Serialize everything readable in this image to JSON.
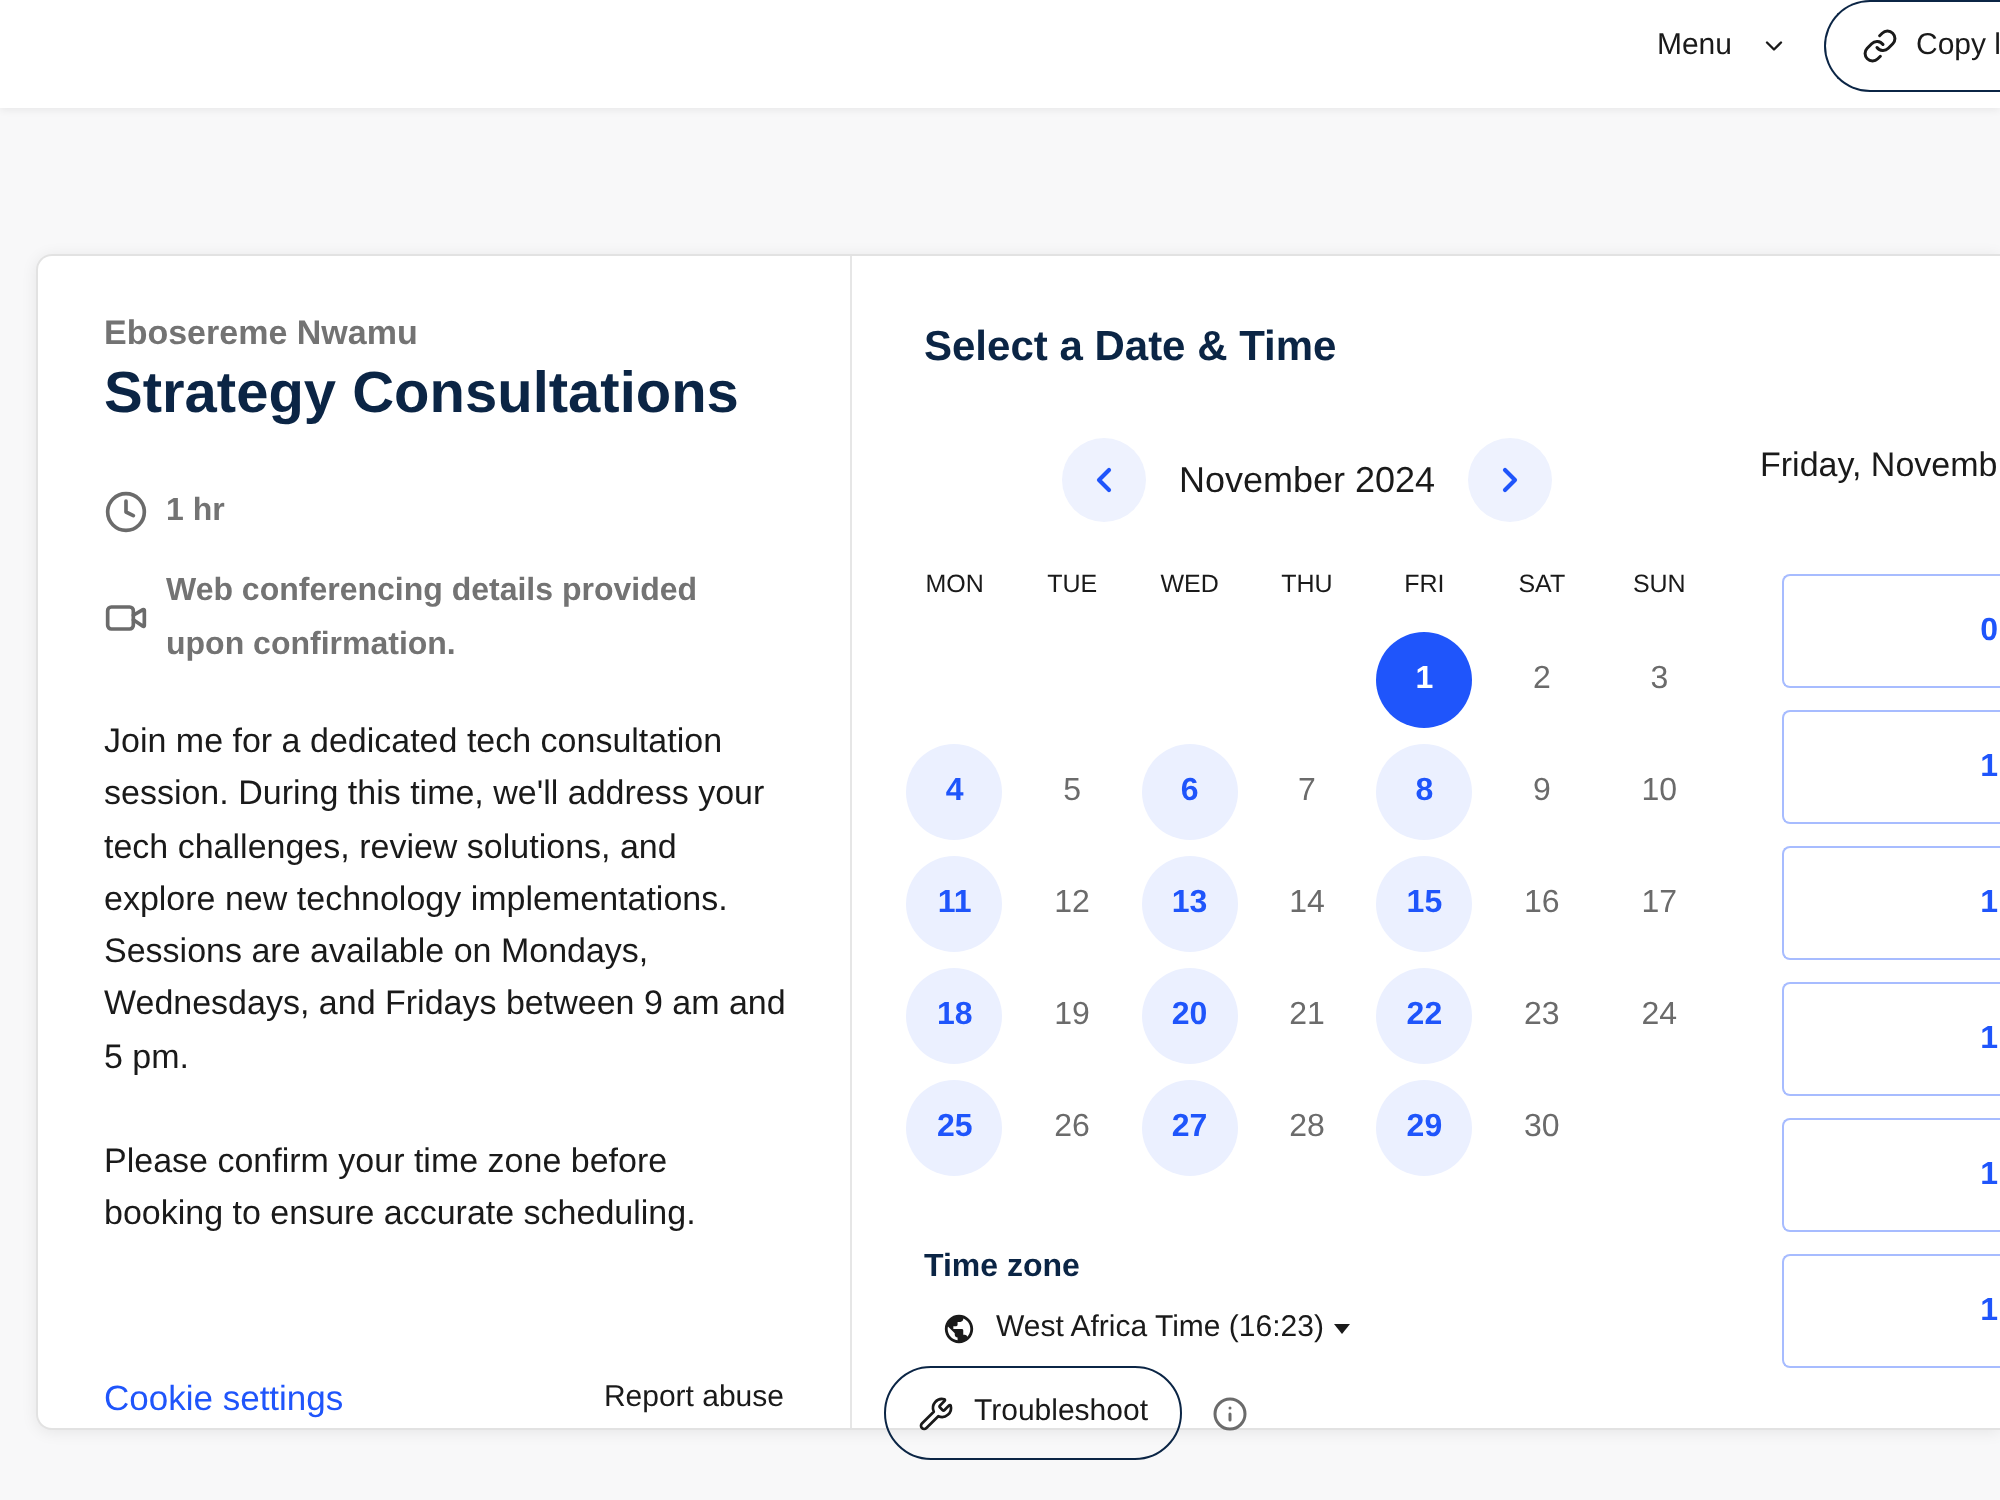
{
  "header": {
    "menu": {
      "label": "Menu"
    },
    "copy_button": {
      "label": "Copy l"
    }
  },
  "event": {
    "host": "Ebosereme Nwamu",
    "title": "Strategy Consultations",
    "details": [
      {
        "kind": "duration",
        "text": "1 hr"
      },
      {
        "kind": "video",
        "text": "Web conferencing details provided upon confirmation."
      }
    ],
    "description": [
      "Join me for a dedicated tech consultation session. During this time, we'll address your tech challenges, review solutions, and explore new technology implementations. Sessions are available on Mondays, Wednesdays, and Fridays between 9 am and 5 pm.",
      "Please confirm your time zone before booking to ensure accurate scheduling."
    ]
  },
  "footer": {
    "cookie_settings": "Cookie settings",
    "report_abuse": "Report abuse"
  },
  "scheduler": {
    "title": "Select a Date & Time",
    "month": "November 2024",
    "weekdays": [
      "MON",
      "TUE",
      "WED",
      "THU",
      "FRI",
      "SAT",
      "SUN"
    ],
    "days": [
      {
        "kind": "blank"
      },
      {
        "kind": "blank"
      },
      {
        "kind": "blank"
      },
      {
        "kind": "blank"
      },
      {
        "kind": "day",
        "label": "1",
        "available": true,
        "selected": true
      },
      {
        "kind": "day",
        "label": "2",
        "available": false,
        "selected": false
      },
      {
        "kind": "day",
        "label": "3",
        "available": false,
        "selected": false
      },
      {
        "kind": "day",
        "label": "4",
        "available": true,
        "selected": false
      },
      {
        "kind": "day",
        "label": "5",
        "available": false,
        "selected": false
      },
      {
        "kind": "day",
        "label": "6",
        "available": true,
        "selected": false
      },
      {
        "kind": "day",
        "label": "7",
        "available": false,
        "selected": false
      },
      {
        "kind": "day",
        "label": "8",
        "available": true,
        "selected": false
      },
      {
        "kind": "day",
        "label": "9",
        "available": false,
        "selected": false
      },
      {
        "kind": "day",
        "label": "10",
        "available": false,
        "selected": false
      },
      {
        "kind": "day",
        "label": "11",
        "available": true,
        "selected": false
      },
      {
        "kind": "day",
        "label": "12",
        "available": false,
        "selected": false
      },
      {
        "kind": "day",
        "label": "13",
        "available": true,
        "selected": false
      },
      {
        "kind": "day",
        "label": "14",
        "available": false,
        "selected": false
      },
      {
        "kind": "day",
        "label": "15",
        "available": true,
        "selected": false
      },
      {
        "kind": "day",
        "label": "16",
        "available": false,
        "selected": false
      },
      {
        "kind": "day",
        "label": "17",
        "available": false,
        "selected": false
      },
      {
        "kind": "day",
        "label": "18",
        "available": true,
        "selected": false
      },
      {
        "kind": "day",
        "label": "19",
        "available": false,
        "selected": false
      },
      {
        "kind": "day",
        "label": "20",
        "available": true,
        "selected": false
      },
      {
        "kind": "day",
        "label": "21",
        "available": false,
        "selected": false
      },
      {
        "kind": "day",
        "label": "22",
        "available": true,
        "selected": false
      },
      {
        "kind": "day",
        "label": "23",
        "available": false,
        "selected": false
      },
      {
        "kind": "day",
        "label": "24",
        "available": false,
        "selected": false
      },
      {
        "kind": "day",
        "label": "25",
        "available": true,
        "selected": false
      },
      {
        "kind": "day",
        "label": "26",
        "available": false,
        "selected": false
      },
      {
        "kind": "day",
        "label": "27",
        "available": true,
        "selected": false
      },
      {
        "kind": "day",
        "label": "28",
        "available": false,
        "selected": false
      },
      {
        "kind": "day",
        "label": "29",
        "available": true,
        "selected": false
      },
      {
        "kind": "day",
        "label": "30",
        "available": false,
        "selected": false
      }
    ],
    "timezone": {
      "label": "Time zone",
      "value": "West Africa Time (16:23)"
    },
    "troubleshoot": "Troubleshoot"
  },
  "slots_panel": {
    "date": "Friday, Novemb",
    "slots": [
      "0",
      "1",
      "1",
      "1",
      "1",
      "1"
    ]
  }
}
